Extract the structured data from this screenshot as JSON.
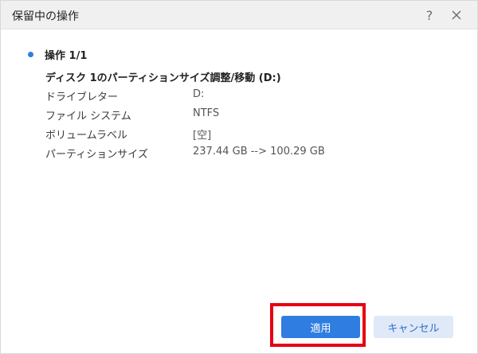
{
  "window": {
    "title": "保留中の操作"
  },
  "operation": {
    "title": "操作 1/1",
    "description": "ディスク 1のパーティションサイズ調整/移動 (D:)",
    "details": [
      {
        "label": "ドライブレター",
        "value": "D:"
      },
      {
        "label": "ファイル システム",
        "value": "NTFS"
      },
      {
        "label": "ボリュームラベル",
        "value": "[空]"
      },
      {
        "label": "パーティションサイズ",
        "value": "237.44 GB --> 100.29 GB"
      }
    ]
  },
  "buttons": {
    "apply": "適用",
    "cancel": "キャンセル"
  },
  "icons": {
    "help": "help-icon",
    "close": "close-icon"
  },
  "colors": {
    "accent": "#2f7de1",
    "highlight": "#e60012"
  }
}
